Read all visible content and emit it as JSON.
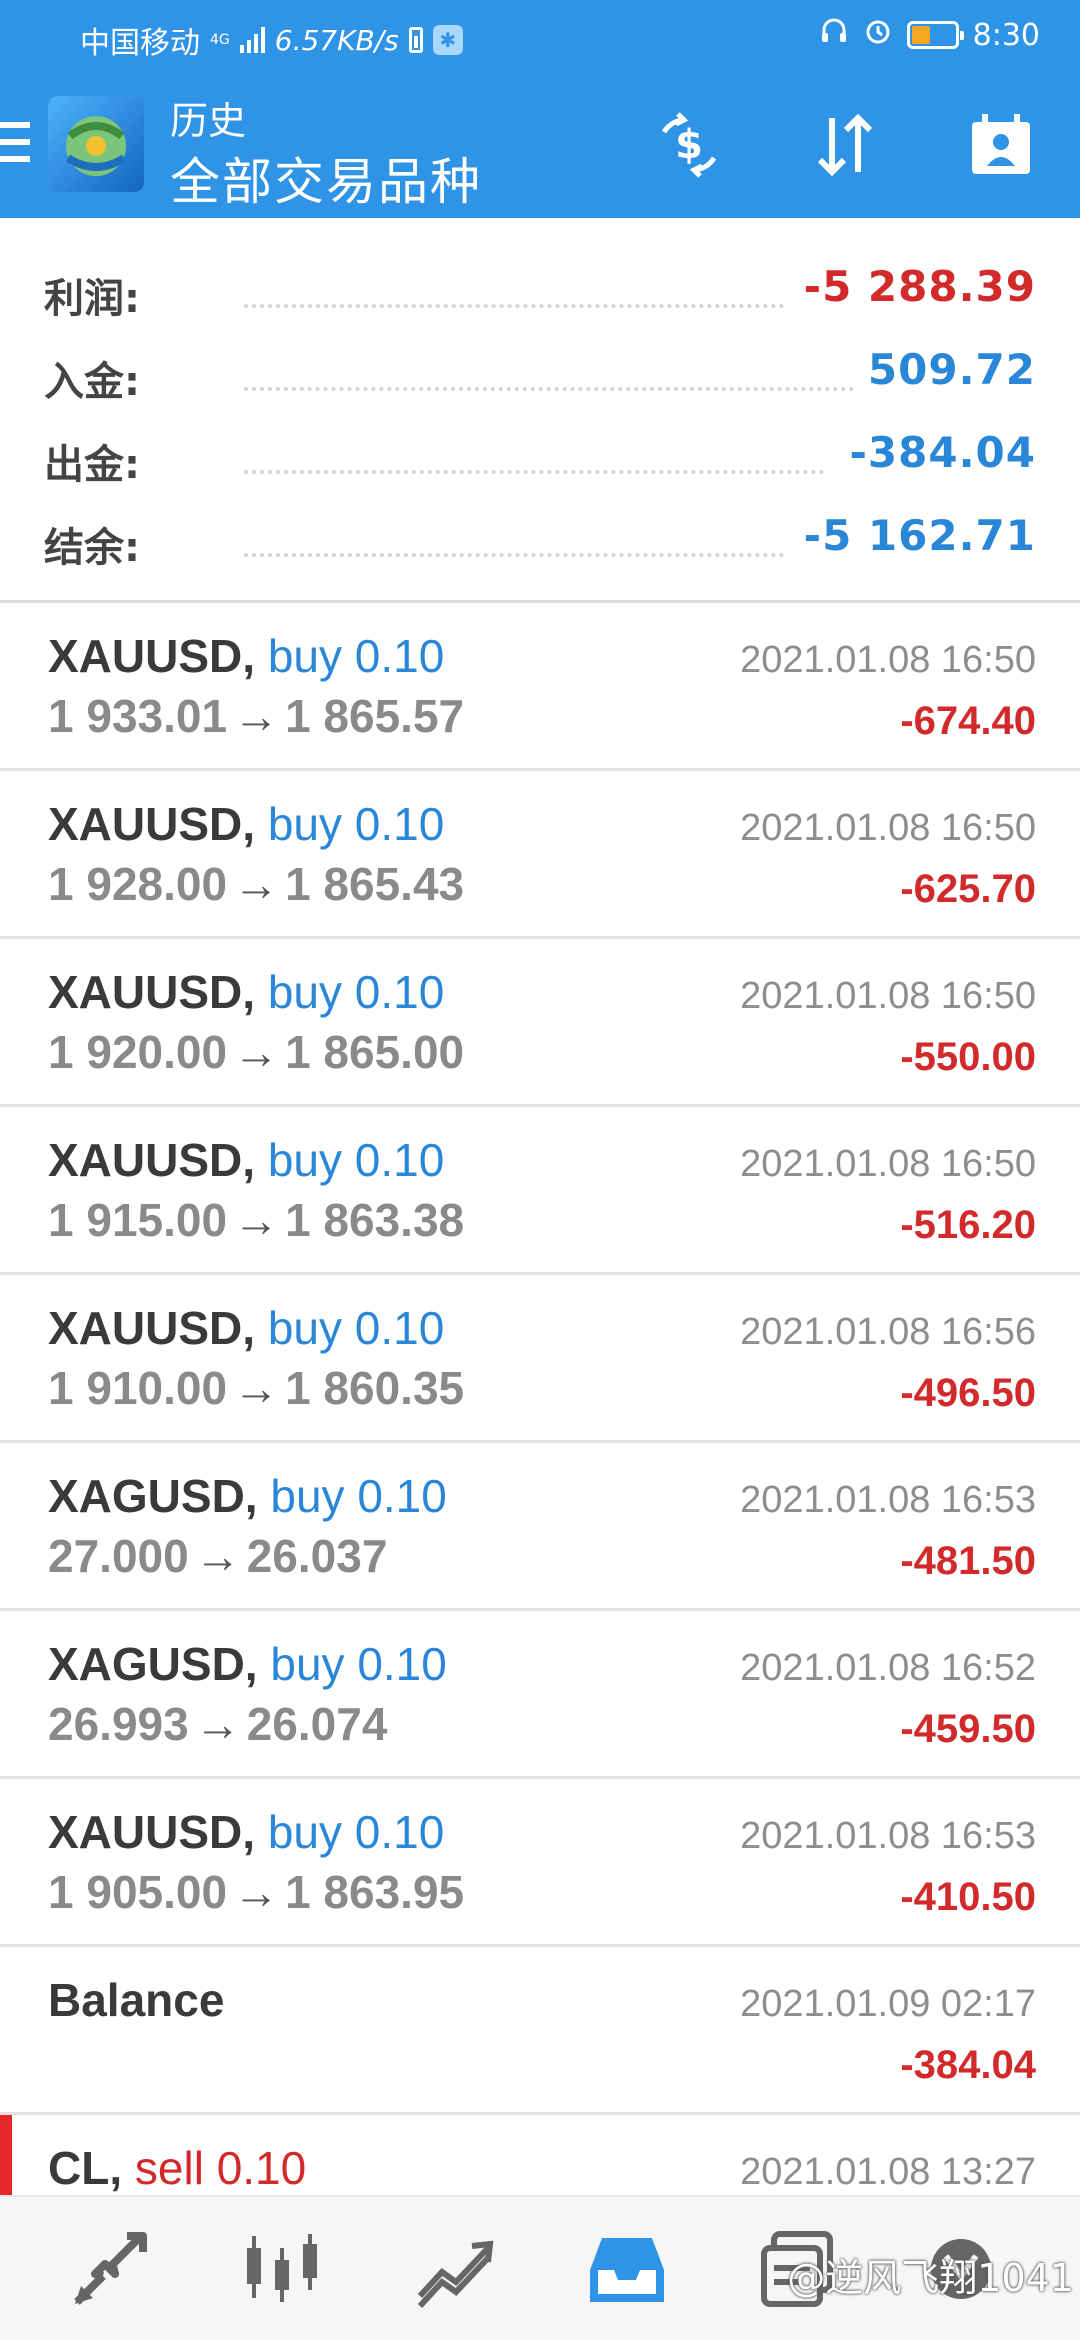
{
  "status_bar": {
    "carrier": "中国移动",
    "network": "4G",
    "speed": "6.57KB/s",
    "time": "8:30"
  },
  "app_bar": {
    "subtitle": "历史",
    "title": "全部交易品种",
    "icons": [
      "menu-icon",
      "app-logo-icon",
      "currency-exchange-icon",
      "sort-icon",
      "account-icon"
    ]
  },
  "summary": {
    "profit_label": "利润:",
    "profit_value": "-5 288.39",
    "deposit_label": "入金:",
    "deposit_value": "509.72",
    "withdrawal_label": "出金:",
    "withdrawal_value": "-384.04",
    "balance_label": "结余:",
    "balance_value": "-5 162.71"
  },
  "trades": [
    {
      "symbol": "XAUUSD,",
      "side": "buy 0.10",
      "open": "1 933.01",
      "close": "1 865.57",
      "time": "2021.01.08 16:50",
      "profit": "-674.40"
    },
    {
      "symbol": "XAUUSD,",
      "side": "buy 0.10",
      "open": "1 928.00",
      "close": "1 865.43",
      "time": "2021.01.08 16:50",
      "profit": "-625.70"
    },
    {
      "symbol": "XAUUSD,",
      "side": "buy 0.10",
      "open": "1 920.00",
      "close": "1 865.00",
      "time": "2021.01.08 16:50",
      "profit": "-550.00"
    },
    {
      "symbol": "XAUUSD,",
      "side": "buy 0.10",
      "open": "1 915.00",
      "close": "1 863.38",
      "time": "2021.01.08 16:50",
      "profit": "-516.20"
    },
    {
      "symbol": "XAUUSD,",
      "side": "buy 0.10",
      "open": "1 910.00",
      "close": "1 860.35",
      "time": "2021.01.08 16:56",
      "profit": "-496.50"
    },
    {
      "symbol": "XAGUSD,",
      "side": "buy 0.10",
      "open": "27.000",
      "close": "26.037",
      "time": "2021.01.08 16:53",
      "profit": "-481.50"
    },
    {
      "symbol": "XAGUSD,",
      "side": "buy 0.10",
      "open": "26.993",
      "close": "26.074",
      "time": "2021.01.08 16:52",
      "profit": "-459.50"
    },
    {
      "symbol": "XAUUSD,",
      "side": "buy 0.10",
      "open": "1 905.00",
      "close": "1 863.95",
      "time": "2021.01.08 16:53",
      "profit": "-410.50"
    }
  ],
  "balance_entry": {
    "label": "Balance",
    "time": "2021.01.09 02:17",
    "amount": "-384.04"
  },
  "partial_trade": {
    "symbol": "CL,",
    "side": "sell 0.10",
    "time": "2021.01.08 13:27"
  },
  "bottom_nav": {
    "items": [
      "trade-icon",
      "chart-icon",
      "analysis-icon",
      "history-icon",
      "messages-icon",
      "settings-icon"
    ],
    "active": "history-icon"
  },
  "watermark": "@逆风飞翔1041",
  "colors": {
    "primary": "#2f93e6",
    "negative": "#d22a2a",
    "positive": "#2a87d8"
  },
  "arrow_glyph": "→"
}
